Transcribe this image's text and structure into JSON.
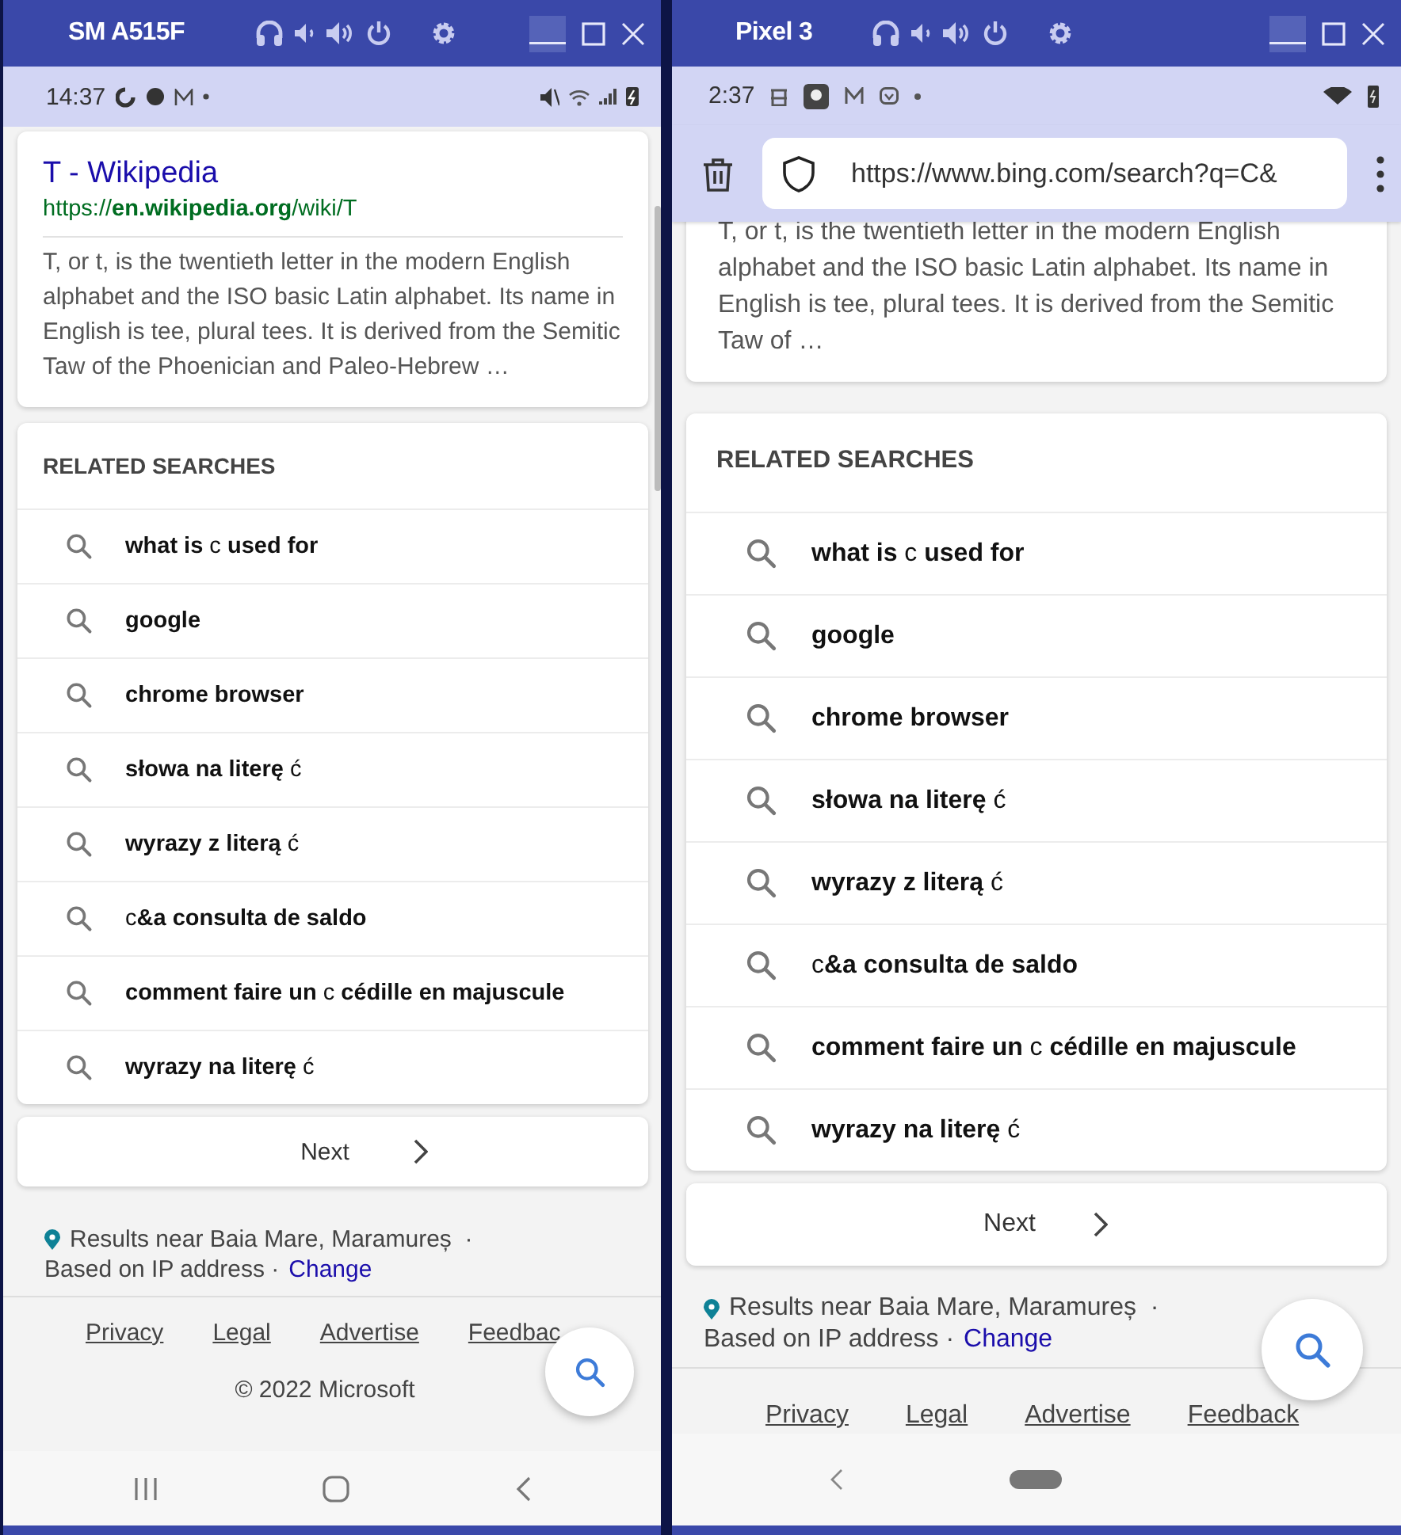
{
  "windows": [
    {
      "title": "SM A515F",
      "status_bar": {
        "time": "14:37"
      },
      "result": {
        "title": "T - Wikipedia",
        "url": "https://**en.wikipedia.org**/wiki/T",
        "snippet": "T, or t, is the twentieth letter in the modern English alphabet and the ISO basic Latin alphabet. Its name in English is tee, plural tees. It is derived from the Semitic Taw of the Phoenician and Paleo-Hebrew …"
      },
      "related": {
        "heading": "RELATED SEARCHES",
        "items": [
          "**what is** c **used for**",
          "**google**",
          "**chrome browser**",
          "**słowa na literę** ć",
          "**wyrazy z literą** ć",
          "c**&a consulta de saldo**",
          "**comment faire un** c **cédille en majuscule**",
          "**wyrazy na literę** ć"
        ]
      },
      "next": "Next",
      "location": {
        "text": "Results near Baia Mare, Maramureș  ·",
        "basis": "Based on IP address ·",
        "link": "Change"
      },
      "footer": {
        "links": [
          "Privacy",
          "Legal",
          "Advertise",
          "Feedbac"
        ],
        "copyright": "© 2022 Microsoft"
      },
      "nav_bar": {
        "kind": "three_button"
      }
    },
    {
      "title": "Pixel 3",
      "status_bar": {
        "time": "2:37"
      },
      "address_bar": {
        "url": "https://www.bing.com/search?q=C&"
      },
      "result": {
        "snippet": "T, or t, is the twentieth letter in the modern English alphabet and the ISO basic Latin alphabet. Its name in English is tee, plural tees. It is derived from the Semitic Taw of …"
      },
      "related": {
        "heading": "RELATED SEARCHES",
        "items": [
          "**what is** c **used for**",
          "**google**",
          "**chrome browser**",
          "**słowa na literę** ć",
          "**wyrazy z literą** ć",
          "c**&a consulta de saldo**",
          "**comment faire un** c **cédille en majuscule**",
          "**wyrazy na literę** ć"
        ]
      },
      "next": "Next",
      "location": {
        "text": "Results near Baia Mare, Maramureș  ·",
        "basis": "Based on IP address ·",
        "link": "Change"
      },
      "footer": {
        "links": [
          "Privacy",
          "Legal",
          "Advertise",
          "Feedback"
        ]
      },
      "nav_bar": {
        "kind": "gesture"
      }
    }
  ]
}
